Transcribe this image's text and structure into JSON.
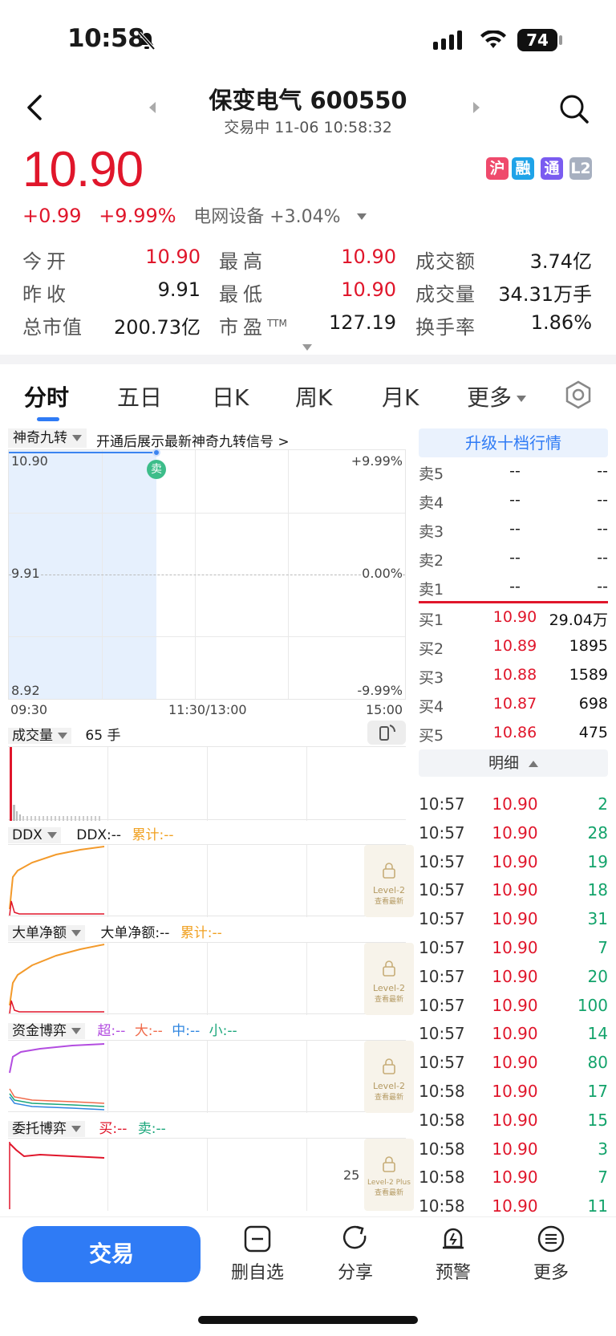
{
  "status_bar": {
    "time": "10:58",
    "battery": "74"
  },
  "header": {
    "title": "保变电气 600550",
    "subtitle": "交易中 11-06 10:58:32"
  },
  "quote": {
    "price": "10.90",
    "change": "+0.99",
    "change_pct": "+9.99%",
    "sector": "电网设备 +3.04%",
    "badges": [
      {
        "text": "沪",
        "color": "#ef4a6c"
      },
      {
        "text": "融",
        "color": "#1fa3e8"
      },
      {
        "text": "通",
        "color": "#7a5cf0"
      },
      {
        "text": "L2",
        "color": "#a7b0c0"
      }
    ]
  },
  "stats": [
    {
      "label": "今开",
      "value": "10.90",
      "color": "red"
    },
    {
      "label": "最高",
      "value": "10.90",
      "color": "red"
    },
    {
      "label": "成交额",
      "value": "3.74亿",
      "color": "black"
    },
    {
      "label": "昨收",
      "value": "9.91",
      "color": "black"
    },
    {
      "label": "最低",
      "value": "10.90",
      "color": "red"
    },
    {
      "label": "成交量",
      "value": "34.31万手",
      "color": "black"
    },
    {
      "label": "总市值",
      "value": "200.73亿",
      "color": "black"
    },
    {
      "label": "市盈",
      "label_sup": "TTM",
      "value": "127.19",
      "color": "black"
    },
    {
      "label": "换手率",
      "value": "1.86%",
      "color": "black"
    }
  ],
  "tabs": [
    "分时",
    "五日",
    "日K",
    "周K",
    "月K",
    "更多"
  ],
  "chart": {
    "indicator": "神奇九转",
    "indicator_hint": "开通后展示最新神奇九转信号 >",
    "y_top": "10.90",
    "y_mid": "9.91",
    "y_bottom": "8.92",
    "pct_top": "+9.99%",
    "pct_mid": "0.00%",
    "pct_bottom": "-9.99%",
    "x_start": "09:30",
    "x_mid": "11:30/13:00",
    "x_end": "15:00",
    "sell_marker": "卖"
  },
  "panels": {
    "volume": {
      "label": "成交量",
      "value": "65 手"
    },
    "ddx": {
      "label": "DDX",
      "v1": "DDX:--",
      "v2": "累计:--"
    },
    "bignet": {
      "label": "大单净额",
      "v1": "大单净额:--",
      "v2": "累计:--"
    },
    "fund": {
      "label": "资金博弈",
      "super": "超:--",
      "big": "大:--",
      "mid": "中:--",
      "small": "小:--"
    },
    "order": {
      "label": "委托博弈",
      "buy": "买:--",
      "sell": "卖:--",
      "right_value": "25"
    },
    "lock_l2": "Level-2",
    "lock_l2plus": "Level-2 Plus",
    "lock_sub": "查看最新"
  },
  "order_book": {
    "upgrade": "升级十档行情",
    "asks": [
      {
        "label": "卖5",
        "price": "--",
        "vol": "--"
      },
      {
        "label": "卖4",
        "price": "--",
        "vol": "--"
      },
      {
        "label": "卖3",
        "price": "--",
        "vol": "--"
      },
      {
        "label": "卖2",
        "price": "--",
        "vol": "--"
      },
      {
        "label": "卖1",
        "price": "--",
        "vol": "--"
      }
    ],
    "bids": [
      {
        "label": "买1",
        "price": "10.90",
        "vol": "29.04万"
      },
      {
        "label": "买2",
        "price": "10.89",
        "vol": "1895"
      },
      {
        "label": "买3",
        "price": "10.88",
        "vol": "1589"
      },
      {
        "label": "买4",
        "price": "10.87",
        "vol": "698"
      },
      {
        "label": "买5",
        "price": "10.86",
        "vol": "475"
      }
    ],
    "detail_label": "明细"
  },
  "ticks": [
    {
      "time": "10:57",
      "price": "10.90",
      "vol": "2"
    },
    {
      "time": "10:57",
      "price": "10.90",
      "vol": "28"
    },
    {
      "time": "10:57",
      "price": "10.90",
      "vol": "19"
    },
    {
      "time": "10:57",
      "price": "10.90",
      "vol": "18"
    },
    {
      "time": "10:57",
      "price": "10.90",
      "vol": "31"
    },
    {
      "time": "10:57",
      "price": "10.90",
      "vol": "7"
    },
    {
      "time": "10:57",
      "price": "10.90",
      "vol": "20"
    },
    {
      "time": "10:57",
      "price": "10.90",
      "vol": "100"
    },
    {
      "time": "10:57",
      "price": "10.90",
      "vol": "14"
    },
    {
      "time": "10:57",
      "price": "10.90",
      "vol": "80"
    },
    {
      "time": "10:58",
      "price": "10.90",
      "vol": "17"
    },
    {
      "time": "10:58",
      "price": "10.90",
      "vol": "15"
    },
    {
      "time": "10:58",
      "price": "10.90",
      "vol": "3"
    },
    {
      "time": "10:58",
      "price": "10.90",
      "vol": "7"
    },
    {
      "time": "10:58",
      "price": "10.90",
      "vol": "11"
    }
  ],
  "bottom_nav": {
    "trade": "交易",
    "items": [
      {
        "label": "删自选",
        "icon": "minus-square-icon"
      },
      {
        "label": "分享",
        "icon": "share-icon"
      },
      {
        "label": "预警",
        "icon": "alert-icon"
      },
      {
        "label": "更多",
        "icon": "more-icon"
      }
    ]
  }
}
